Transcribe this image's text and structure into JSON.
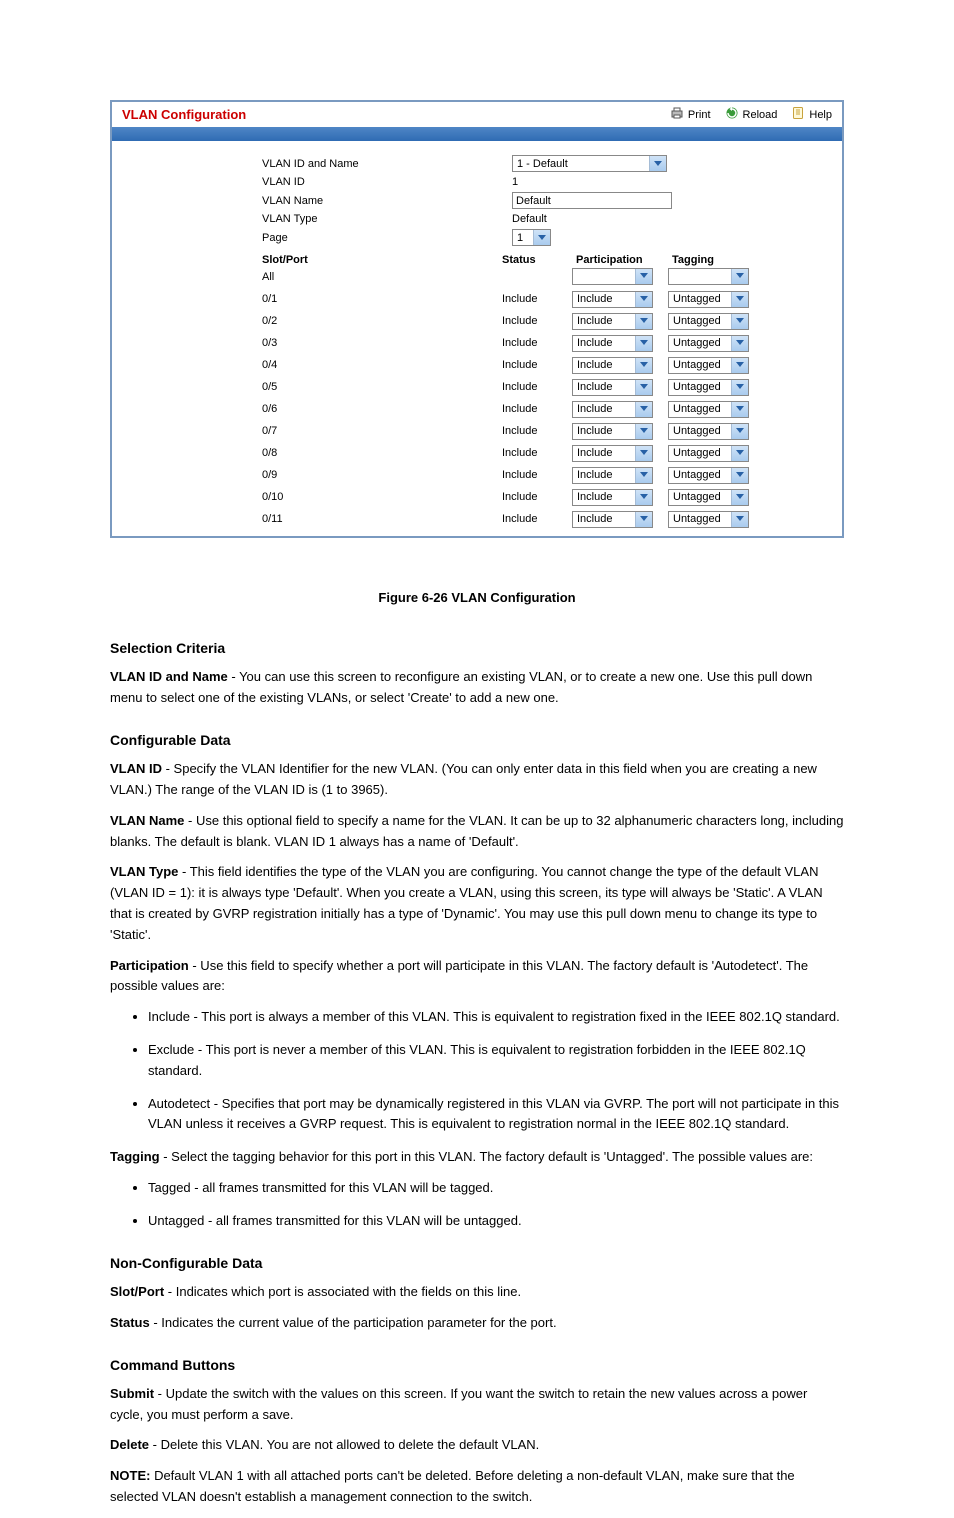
{
  "panel": {
    "title": "VLAN Configuration",
    "tools": {
      "print": "Print",
      "reload": "Reload",
      "help": "Help"
    }
  },
  "form": {
    "labels": {
      "vlan_id_and_name": "VLAN ID and Name",
      "vlan_id": "VLAN ID",
      "vlan_name": "VLAN Name",
      "vlan_type": "VLAN Type",
      "page": "Page"
    },
    "values": {
      "vlan_id_and_name_selected": "1 - Default",
      "vlan_id": "1",
      "vlan_name": "Default",
      "vlan_type": "Default",
      "page": "1"
    }
  },
  "table": {
    "headers": {
      "slotport": "Slot/Port",
      "status": "Status",
      "participation": "Participation",
      "tagging": "Tagging"
    },
    "all_row": {
      "slotport": "All",
      "status": "",
      "participation": "",
      "tagging": ""
    },
    "rows": [
      {
        "slotport": "0/1",
        "status": "Include",
        "participation": "Include",
        "tagging": "Untagged"
      },
      {
        "slotport": "0/2",
        "status": "Include",
        "participation": "Include",
        "tagging": "Untagged"
      },
      {
        "slotport": "0/3",
        "status": "Include",
        "participation": "Include",
        "tagging": "Untagged"
      },
      {
        "slotport": "0/4",
        "status": "Include",
        "participation": "Include",
        "tagging": "Untagged"
      },
      {
        "slotport": "0/5",
        "status": "Include",
        "participation": "Include",
        "tagging": "Untagged"
      },
      {
        "slotport": "0/6",
        "status": "Include",
        "participation": "Include",
        "tagging": "Untagged"
      },
      {
        "slotport": "0/7",
        "status": "Include",
        "participation": "Include",
        "tagging": "Untagged"
      },
      {
        "slotport": "0/8",
        "status": "Include",
        "participation": "Include",
        "tagging": "Untagged"
      },
      {
        "slotport": "0/9",
        "status": "Include",
        "participation": "Include",
        "tagging": "Untagged"
      },
      {
        "slotport": "0/10",
        "status": "Include",
        "participation": "Include",
        "tagging": "Untagged"
      },
      {
        "slotport": "0/11",
        "status": "Include",
        "participation": "Include",
        "tagging": "Untagged"
      }
    ]
  },
  "doc": {
    "fig_caption": "Figure 6-26 VLAN Configuration",
    "selection_hdr": "Selection Criteria",
    "selection_body": "VLAN ID and Name - You can use this screen to reconfigure an existing VLAN, or to create a new one. Use this pull down menu to select one of the existing VLANs, or select 'Create' to add a new one.",
    "config_hdr": "Configurable Data",
    "config_intro": "VLAN ID - Specify the VLAN Identifier for the new VLAN. (You can only enter data in this field when you are creating a new VLAN.) The range of the VLAN ID is (1 to 3965).",
    "config_vlan_name": "VLAN Name - Use this optional field to specify a name for the VLAN. It can be up to 32 alphanumeric characters long, including blanks. The default is blank. VLAN ID 1 always has a name of 'Default'.",
    "config_vlan_type": "VLAN Type - This field identifies the type of the VLAN you are configuring. You cannot change the type of the default VLAN (VLAN ID = 1): it is always type 'Default'. When you create a VLAN, using this screen, its type will always be 'Static'. A VLAN that is created by GVRP registration initially has a type of 'Dynamic'. You may use this pull down menu to change its type to 'Static'.",
    "participation_intro": "Participation - Use this field to specify whether a port will participate in this VLAN. The factory default is 'Autodetect'. The possible values are:",
    "participation_items": {
      "include": "Include - This port is always a member of this VLAN. This is equivalent to registration fixed in the IEEE 802.1Q standard.",
      "exclude": "Exclude - This port is never a member of this VLAN. This is equivalent to registration forbidden in the IEEE 802.1Q standard.",
      "autodetect": "Autodetect - Specifies that port may be dynamically registered in this VLAN via GVRP. The port will not participate in this VLAN unless it receives a GVRP request. This is equivalent to registration normal in the IEEE 802.1Q standard."
    },
    "tagging_intro": "Tagging - Select the tagging behavior for this port in this VLAN. The factory default is 'Untagged'. The possible values are:",
    "tagging_items": {
      "tagged": "Tagged - all frames transmitted for this VLAN will be tagged.",
      "untagged": "Untagged - all frames transmitted for this VLAN will be untagged."
    },
    "nonconfig_hdr": "Non-Configurable Data",
    "nonconfig_body": "Slot/Port - Indicates which port is associated with the fields on this line.",
    "status_intro": "Status - Indicates the current value of the participation parameter for the port.",
    "buttons_hdr": "Command Buttons",
    "buttons_body": "Submit - Update the switch with the values on this screen. If you want the switch to retain the new values across a power cycle, you must perform a save.",
    "buttons_delete": "Delete - Delete this VLAN. You are not allowed to delete the default VLAN.",
    "note_hdr": "NOTE:",
    "note_body": " Default VLAN 1 with all attached ports can't be deleted. Before deleting a non-default VLAN, make sure that the selected VLAN doesn't establish a management connection to the switch."
  }
}
